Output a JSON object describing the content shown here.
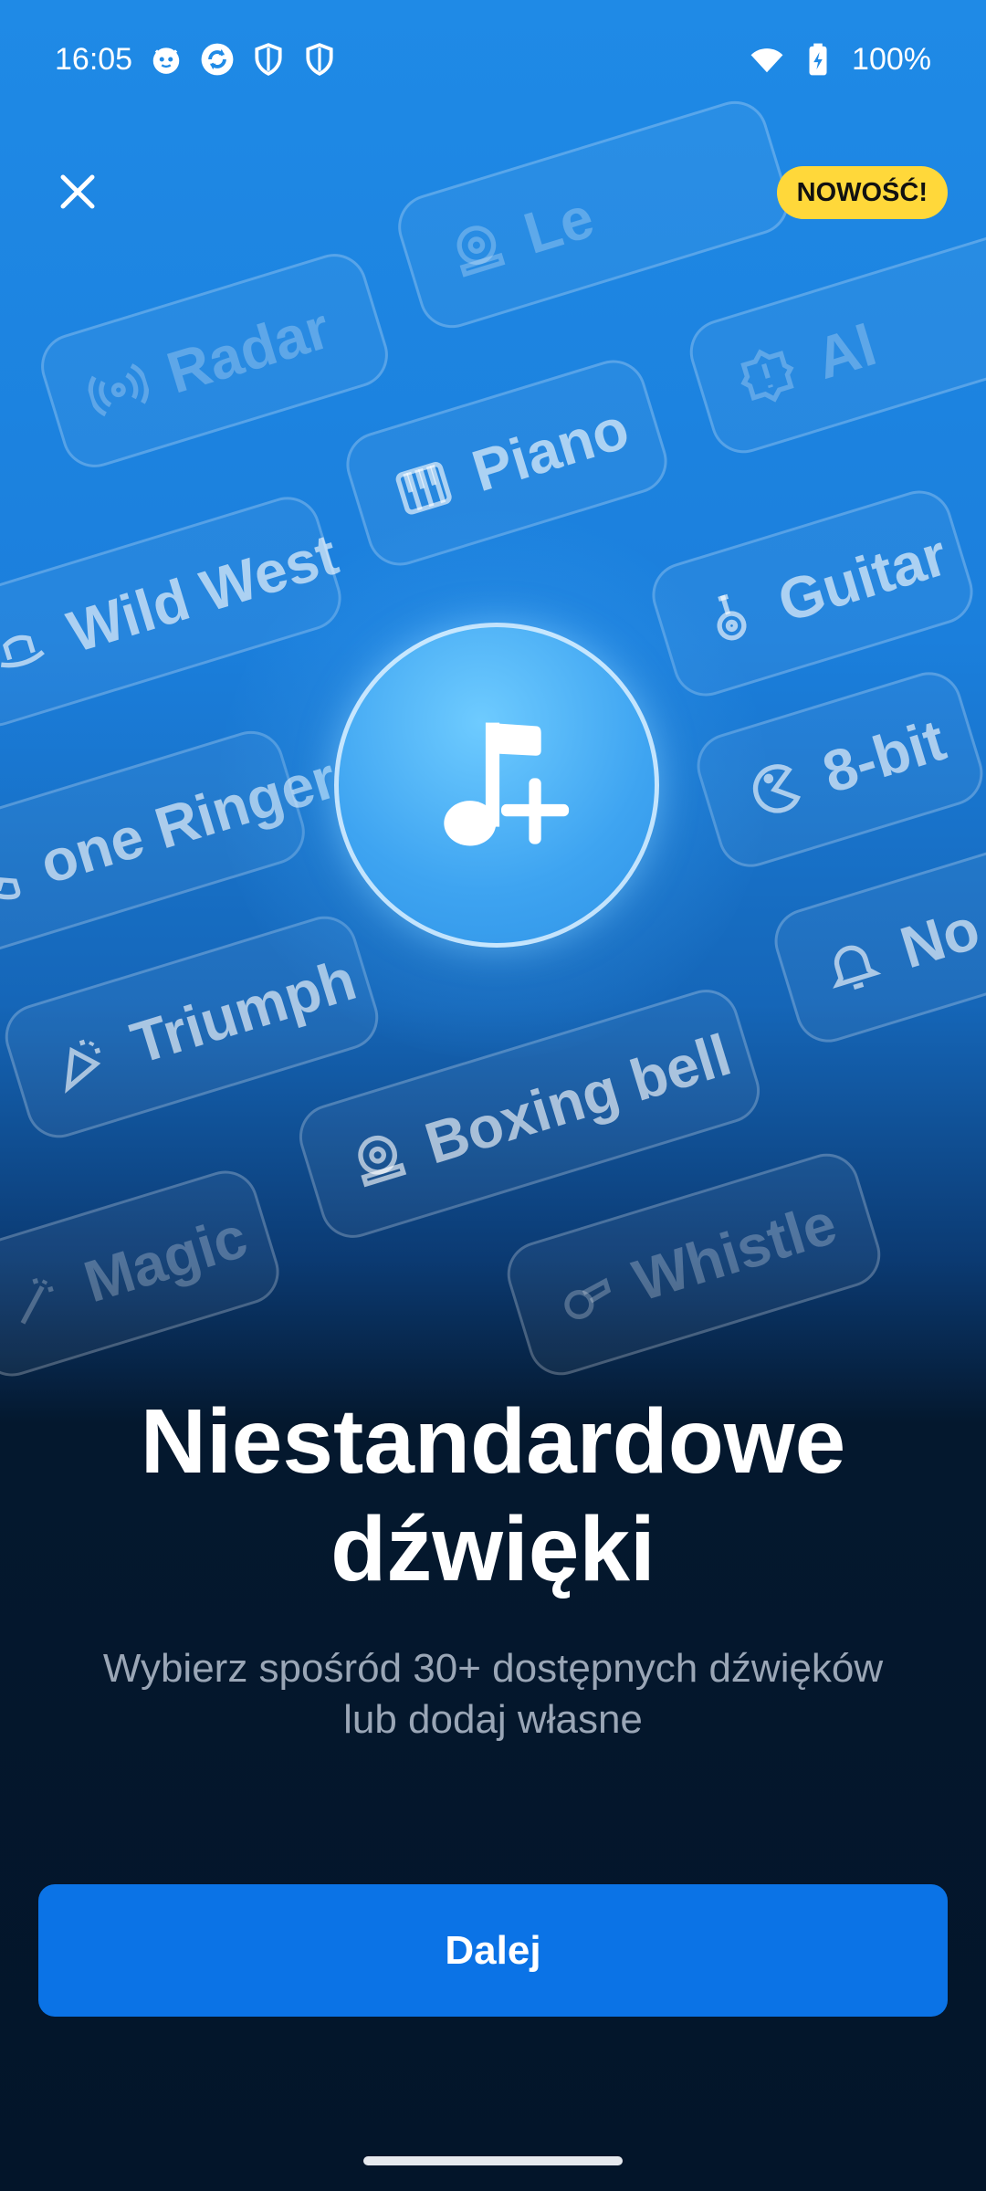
{
  "status_bar": {
    "time": "16:05",
    "battery": "100%",
    "left_icons": [
      "cat-face-icon",
      "sync-icon",
      "shield-icon",
      "shield-icon"
    ],
    "right_icons": [
      "wifi-icon",
      "battery-charging-icon"
    ]
  },
  "header": {
    "close_icon": "close-icon",
    "badge": "NOWOŚĆ!",
    "badge_color": "#ffd83a"
  },
  "sound_pills": [
    {
      "label": "Le",
      "icon": "boxing-bell-icon"
    },
    {
      "label": "Radar",
      "icon": "radar-icon"
    },
    {
      "label": "Al",
      "icon": "alert-icon"
    },
    {
      "label": "Piano",
      "icon": "piano-icon"
    },
    {
      "label": "Wild West",
      "icon": "wild-west-icon"
    },
    {
      "label": "Guitar",
      "icon": "guitar-icon"
    },
    {
      "label": "one Ringer",
      "icon": "phone-icon"
    },
    {
      "label": "8-bit",
      "icon": "pacman-icon"
    },
    {
      "label": "Triumph",
      "icon": "party-icon"
    },
    {
      "label": "No",
      "icon": "bell-icon"
    },
    {
      "label": "Boxing bell",
      "icon": "boxing-bell-icon"
    },
    {
      "label": "Magic",
      "icon": "magic-icon"
    },
    {
      "label": "Whistle",
      "icon": "whistle-icon"
    }
  ],
  "hero": {
    "icon": "music-note-plus-icon"
  },
  "main": {
    "title_line1": "Niestandardowe",
    "title_line2": "dźwięki",
    "subtitle_line1": "Wybierz spośród 30+ dostępnych dźwięków",
    "subtitle_line2": "lub dodaj własne"
  },
  "footer": {
    "next_label": "Dalej",
    "button_color": "#0b73e6"
  }
}
